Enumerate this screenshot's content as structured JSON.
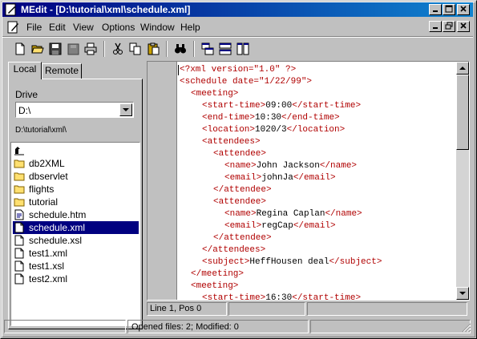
{
  "window": {
    "title": "MEdit - [D:\\tutorial\\xml\\schedule.xml]"
  },
  "menu": {
    "items": [
      "File",
      "Edit",
      "View",
      "Options",
      "Window",
      "Help"
    ]
  },
  "tabs": [
    "Local",
    "Remote"
  ],
  "left": {
    "drive_label": "Drive",
    "drive_value": "D:\\",
    "path": "D:\\tutorial\\xml\\",
    "files": [
      {
        "name": "",
        "icon": "up-folder-icon"
      },
      {
        "name": "db2XML",
        "icon": "folder-icon"
      },
      {
        "name": "dbservlet",
        "icon": "folder-icon"
      },
      {
        "name": "flights",
        "icon": "folder-icon"
      },
      {
        "name": "tutorial",
        "icon": "folder-icon"
      },
      {
        "name": "schedule.htm",
        "icon": "html-file-icon"
      },
      {
        "name": "schedule.xml",
        "icon": "document-icon",
        "selected": true
      },
      {
        "name": "schedule.xsl",
        "icon": "document-icon"
      },
      {
        "name": "test1.xml",
        "icon": "document-icon"
      },
      {
        "name": "test1.xsl",
        "icon": "document-icon"
      },
      {
        "name": "test2.xml",
        "icon": "document-icon"
      }
    ]
  },
  "editor": {
    "lines": [
      {
        "indent": 0,
        "parts": [
          [
            "tag",
            "<?xml version=\"1.0\" ?>"
          ]
        ]
      },
      {
        "indent": 0,
        "parts": [
          [
            "tag",
            "<schedule date=\"1/22/99\">"
          ]
        ]
      },
      {
        "indent": 2,
        "parts": [
          [
            "tag",
            "<meeting>"
          ]
        ]
      },
      {
        "indent": 4,
        "parts": [
          [
            "tag",
            "<start-time>"
          ],
          [
            "txt",
            "09:00"
          ],
          [
            "tag",
            "</start-time>"
          ]
        ]
      },
      {
        "indent": 4,
        "parts": [
          [
            "tag",
            "<end-time>"
          ],
          [
            "txt",
            "10:30"
          ],
          [
            "tag",
            "</end-time>"
          ]
        ]
      },
      {
        "indent": 4,
        "parts": [
          [
            "tag",
            "<location>"
          ],
          [
            "txt",
            "1020/3"
          ],
          [
            "tag",
            "</location>"
          ]
        ]
      },
      {
        "indent": 4,
        "parts": [
          [
            "tag",
            "<attendees>"
          ]
        ]
      },
      {
        "indent": 6,
        "parts": [
          [
            "tag",
            "<attendee>"
          ]
        ]
      },
      {
        "indent": 8,
        "parts": [
          [
            "tag",
            "<name>"
          ],
          [
            "txt",
            "John Jackson"
          ],
          [
            "tag",
            "</name>"
          ]
        ]
      },
      {
        "indent": 8,
        "parts": [
          [
            "tag",
            "<email>"
          ],
          [
            "txt",
            "johnJa"
          ],
          [
            "tag",
            "</email>"
          ]
        ]
      },
      {
        "indent": 6,
        "parts": [
          [
            "tag",
            "</attendee>"
          ]
        ]
      },
      {
        "indent": 6,
        "parts": [
          [
            "tag",
            "<attendee>"
          ]
        ]
      },
      {
        "indent": 8,
        "parts": [
          [
            "tag",
            "<name>"
          ],
          [
            "txt",
            "Regina Caplan"
          ],
          [
            "tag",
            "</name>"
          ]
        ]
      },
      {
        "indent": 8,
        "parts": [
          [
            "tag",
            "<email>"
          ],
          [
            "txt",
            "regCap"
          ],
          [
            "tag",
            "</email>"
          ]
        ]
      },
      {
        "indent": 6,
        "parts": [
          [
            "tag",
            "</attendee>"
          ]
        ]
      },
      {
        "indent": 4,
        "parts": [
          [
            "tag",
            "</attendees>"
          ]
        ]
      },
      {
        "indent": 4,
        "parts": [
          [
            "tag",
            "<subject>"
          ],
          [
            "txt",
            "HeffHousen deal"
          ],
          [
            "tag",
            "</subject>"
          ]
        ]
      },
      {
        "indent": 2,
        "parts": [
          [
            "tag",
            "</meeting>"
          ]
        ]
      },
      {
        "indent": 2,
        "parts": [
          [
            "tag",
            "<meeting>"
          ]
        ]
      },
      {
        "indent": 4,
        "parts": [
          [
            "tag",
            "<start-time>"
          ],
          [
            "txt",
            "16:30"
          ],
          [
            "tag",
            "</start-time>"
          ]
        ]
      }
    ],
    "position": "Line 1, Pos 0"
  },
  "status": {
    "text": "Opened files: 2; Modified: 0"
  },
  "colors": {
    "titlebar": "#000080",
    "tag": "#b00000",
    "selection": "#000080"
  }
}
